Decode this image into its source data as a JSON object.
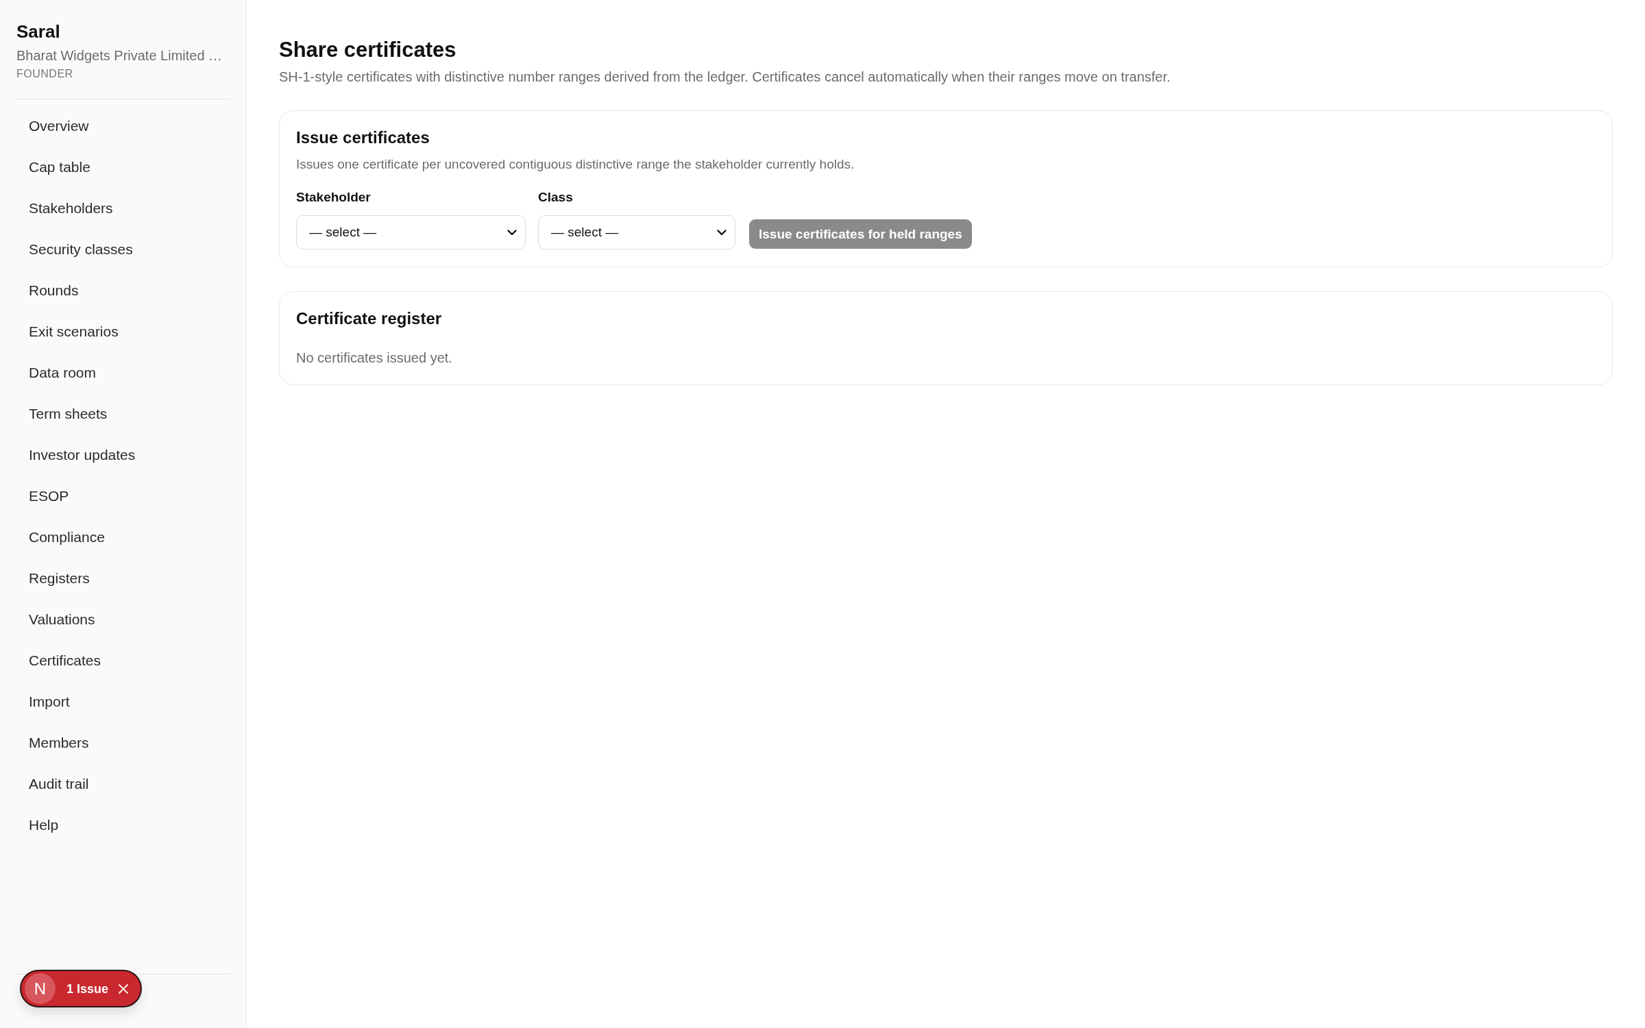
{
  "sidebar": {
    "app_name": "Saral",
    "company": "Bharat Widgets Private Limited …",
    "role": "FOUNDER",
    "items": [
      "Overview",
      "Cap table",
      "Stakeholders",
      "Security classes",
      "Rounds",
      "Exit scenarios",
      "Data room",
      "Term sheets",
      "Investor updates",
      "ESOP",
      "Compliance",
      "Registers",
      "Valuations",
      "Certificates",
      "Import",
      "Members",
      "Audit trail",
      "Help"
    ]
  },
  "page": {
    "title": "Share certificates",
    "subtitle": "SH-1-style certificates with distinctive number ranges derived from the ledger. Certificates cancel automatically when their ranges move on transfer."
  },
  "issue_card": {
    "title": "Issue certificates",
    "description": "Issues one certificate per uncovered contiguous distinctive range the stakeholder currently holds.",
    "fields": [
      {
        "label": "Stakeholder",
        "value": "— select —"
      },
      {
        "label": "Class",
        "value": "— select —"
      }
    ],
    "button": {
      "label": "Issue certificates for held ranges",
      "disabled": true
    }
  },
  "register_card": {
    "title": "Certificate register",
    "empty_message": "No certificates issued yet."
  },
  "dev_indicator": {
    "logo_letter": "N",
    "label": "1 Issue"
  }
}
